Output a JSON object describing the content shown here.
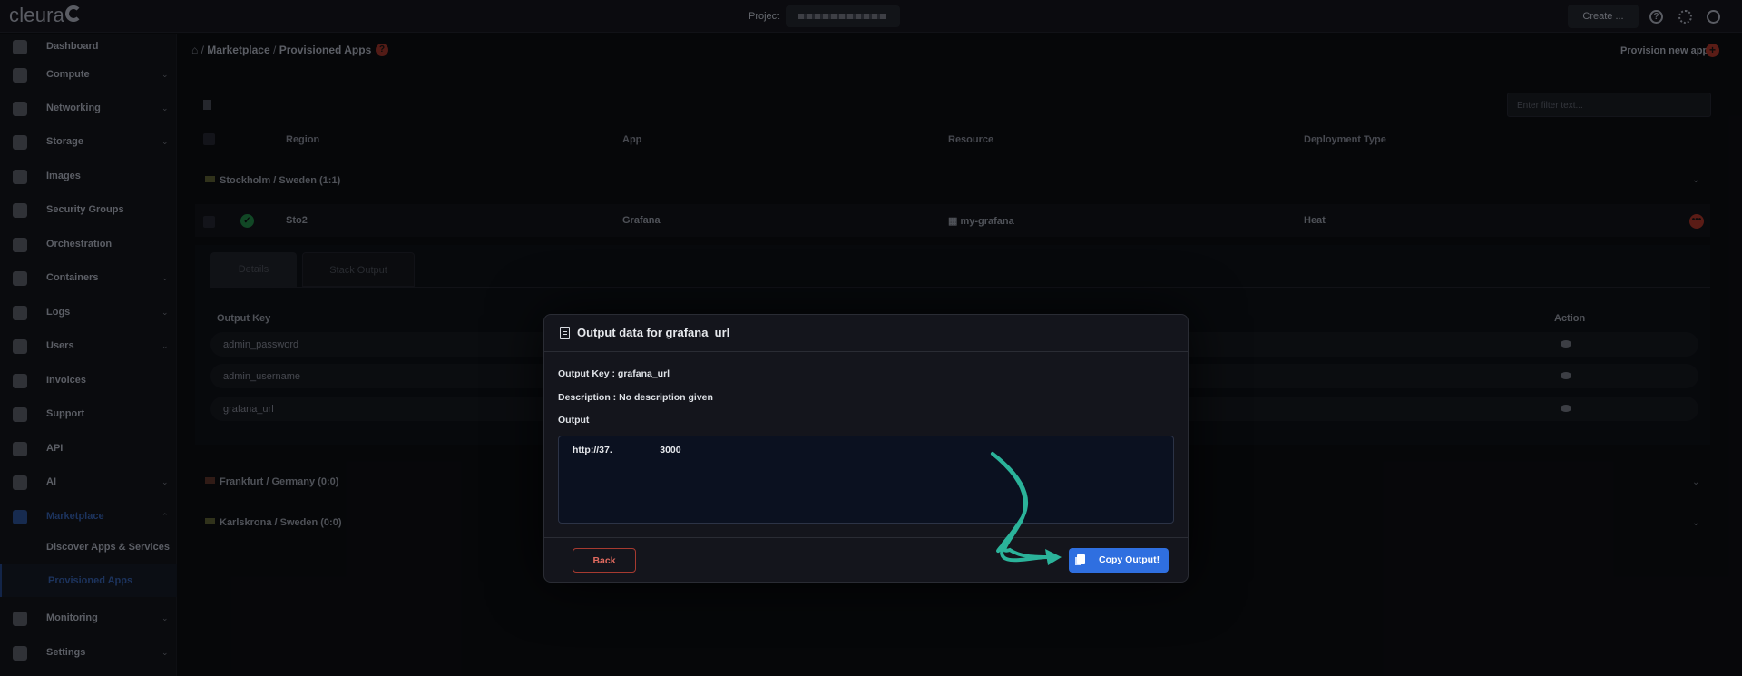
{
  "topbar": {
    "logo": "cleura",
    "project_label": "Project",
    "create_label": "Create ..."
  },
  "sidebar": {
    "items": [
      {
        "label": "Dashboard",
        "icon": "chart-area-icon",
        "chevron": false
      },
      {
        "label": "Compute",
        "icon": "server-icon",
        "chevron": true
      },
      {
        "label": "Networking",
        "icon": "network-icon",
        "chevron": true
      },
      {
        "label": "Storage",
        "icon": "database-icon",
        "chevron": true
      },
      {
        "label": "Images",
        "icon": "camera-icon",
        "chevron": false
      },
      {
        "label": "Security Groups",
        "icon": "shield-icon",
        "chevron": false
      },
      {
        "label": "Orchestration",
        "icon": "orchestration-icon",
        "chevron": false
      },
      {
        "label": "Containers",
        "icon": "cube-icon",
        "chevron": true
      },
      {
        "label": "Logs",
        "icon": "history-icon",
        "chevron": true
      },
      {
        "label": "Users",
        "icon": "user-icon",
        "chevron": true
      },
      {
        "label": "Invoices",
        "icon": "calculator-icon",
        "chevron": false
      },
      {
        "label": "Support",
        "icon": "lifebuoy-icon",
        "chevron": false
      },
      {
        "label": "API",
        "icon": "plug-icon",
        "chevron": false
      },
      {
        "label": "AI",
        "icon": "ai-icon",
        "chevron": true
      },
      {
        "label": "Marketplace",
        "icon": "cart-icon",
        "chevron": true
      },
      {
        "label": "Monitoring",
        "icon": "chart-line-icon",
        "chevron": true
      },
      {
        "label": "Settings",
        "icon": "gear-icon",
        "chevron": true
      }
    ],
    "marketplace_sub": [
      "Discover Apps & Services",
      "Provisioned Apps"
    ]
  },
  "breadcrumb": {
    "sep": "/",
    "items": [
      "Marketplace",
      "Provisioned Apps"
    ]
  },
  "provision_label": "Provision new app",
  "filter_placeholder": "Enter filter text...",
  "table": {
    "headers": [
      "Region",
      "App",
      "Resource",
      "Deployment Type"
    ],
    "groups": [
      "Stockholm / Sweden (1:1)",
      "Frankfurt / Germany (0:0)",
      "Karlskrona / Sweden (0:0)"
    ],
    "row": {
      "region": "Sto2",
      "app": "Grafana",
      "resource": "my-grafana",
      "deployment": "Heat"
    }
  },
  "details": {
    "tabs": [
      "Details",
      "Stack Output"
    ],
    "headers": [
      "Output Key",
      "Action"
    ],
    "keys": [
      "admin_password",
      "admin_username",
      "grafana_url"
    ]
  },
  "modal": {
    "title": "Output data for grafana_url",
    "output_key": "Output Key : grafana_url",
    "description": "Description : No description given",
    "output_label": "Output",
    "output_value": "http://37.     3000",
    "back_label": "Back",
    "copy_label": "Copy Output!"
  },
  "colors": {
    "accent": "#2f6fe0",
    "danger": "#e16a5f",
    "arrow": "#2bb39a"
  }
}
